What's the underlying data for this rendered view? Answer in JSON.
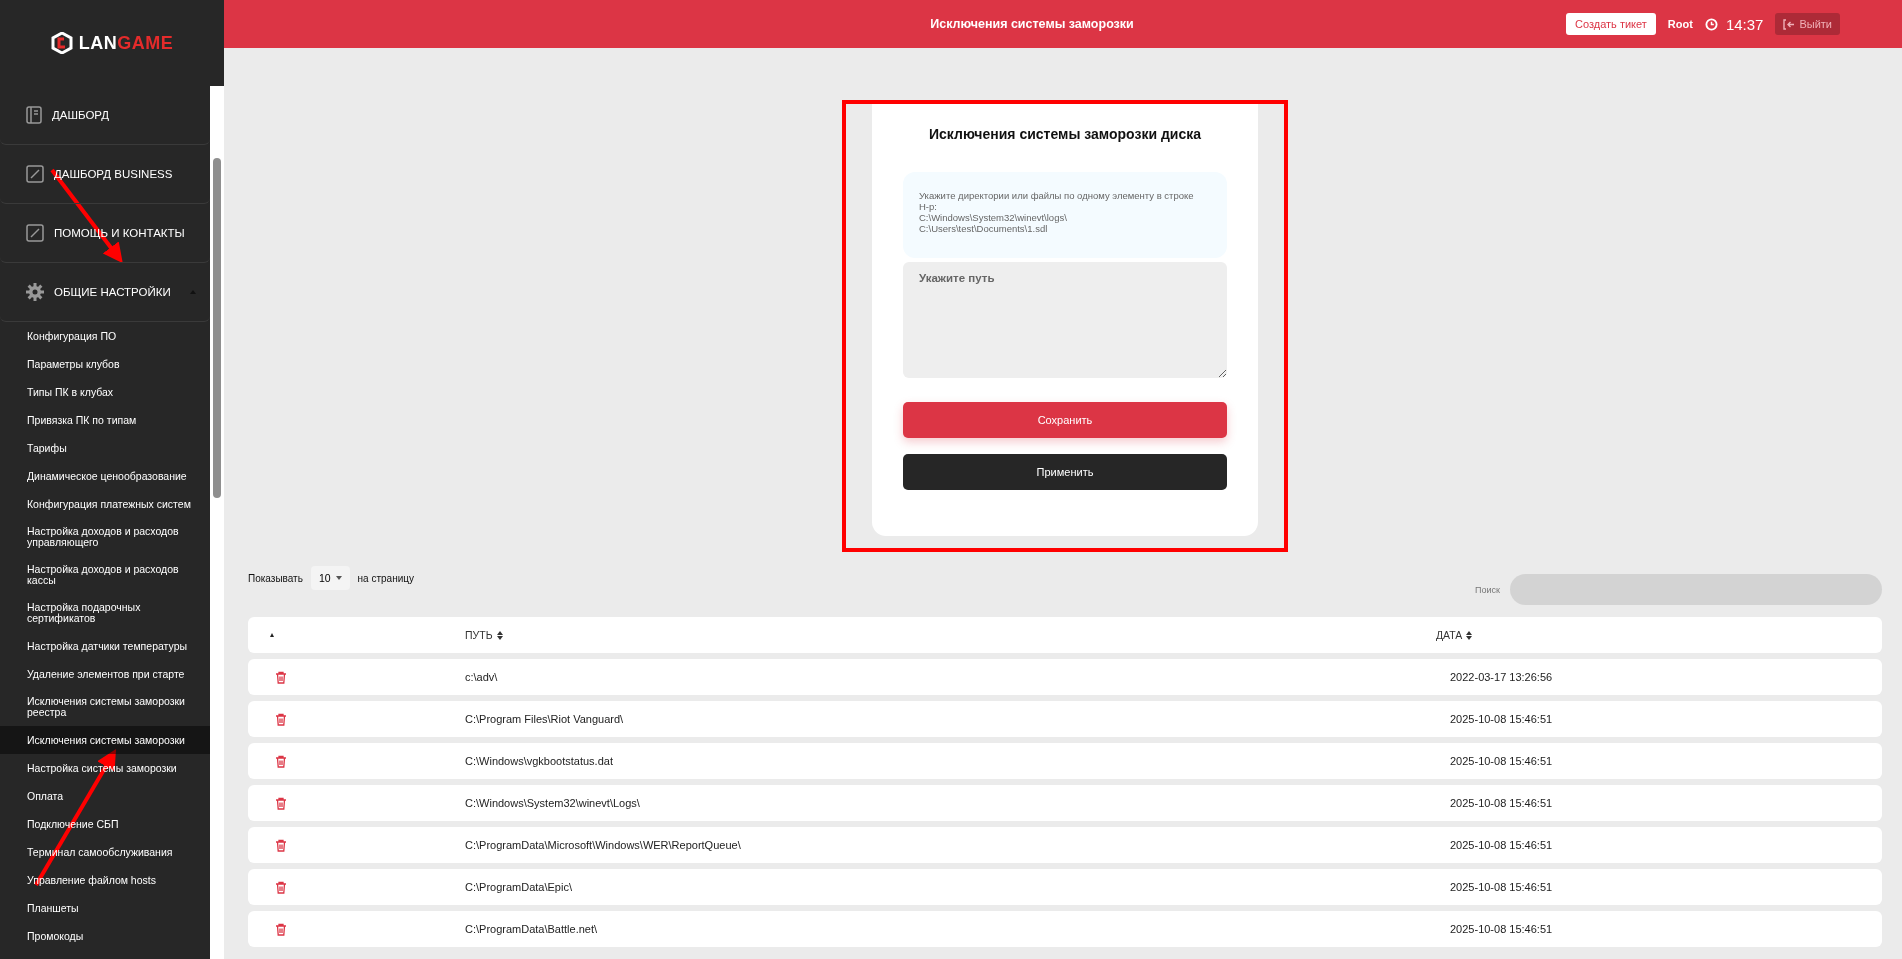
{
  "logo": {
    "text": "LAN",
    "accent": "GAME"
  },
  "sidebar": {
    "items": [
      {
        "kind": "dashboard",
        "label": "ДАШБОРД"
      },
      {
        "kind": "link",
        "label": "ДАШБОРД BUSINESS"
      },
      {
        "kind": "link",
        "label": "ПОМОЩЬ И КОНТАКТЫ"
      },
      {
        "kind": "group",
        "label": "ОБЩИЕ НАСТРОЙКИ",
        "expanded": true,
        "children": [
          {
            "label": "Конфигурация ПО",
            "selected": false
          },
          {
            "label": "Параметры клубов",
            "selected": false
          },
          {
            "label": "Типы ПК в клубах",
            "selected": false
          },
          {
            "label": "Привязка ПК по типам",
            "selected": false
          },
          {
            "label": "Тарифы",
            "selected": false
          },
          {
            "label": "Динамическое ценообразование",
            "selected": false
          },
          {
            "label": "Конфигурация платежных систем",
            "selected": false
          },
          {
            "label": "Настройка доходов и расходов управляющего",
            "selected": false
          },
          {
            "label": "Настройка доходов и расходов кассы",
            "selected": false
          },
          {
            "label": "Настройка подарочных сертификатов",
            "selected": false
          },
          {
            "label": "Настройка датчики температуры",
            "selected": false
          },
          {
            "label": "Удаление элементов при старте",
            "selected": false
          },
          {
            "label": "Исключения системы заморозки реестра",
            "selected": false
          },
          {
            "label": "Исключения системы заморозки",
            "selected": true
          },
          {
            "label": "Настройка системы заморозки",
            "selected": false
          },
          {
            "label": "Оплата",
            "selected": false
          },
          {
            "label": "Подключение СБП",
            "selected": false
          },
          {
            "label": "Терминал самообслуживания",
            "selected": false
          },
          {
            "label": "Управление файлом hosts",
            "selected": false
          },
          {
            "label": "Планшеты",
            "selected": false
          },
          {
            "label": "Промокоды",
            "selected": false
          }
        ]
      }
    ]
  },
  "header": {
    "title": "Исключения системы заморозки",
    "ticket_button": "Создать тикет",
    "user": "Root",
    "time": "14:37",
    "logout_button": "Выйти"
  },
  "card": {
    "title": "Исключения системы заморозки диска",
    "hint": "Укажите директории или файлы по одному элементу в строке\nН-р:\nC:\\Windows\\System32\\winevt\\logs\\\nC:\\Users\\test\\Documents\\1.sdl",
    "path_field": {
      "placeholder": "Укажите путь"
    },
    "save_button": "Сохранить",
    "apply_button": "Применить"
  },
  "pagination": {
    "show_label": "Показывать",
    "page_size": "10",
    "per_page_label": "на страницу"
  },
  "search": {
    "label": "Поиск"
  },
  "table": {
    "columns": [
      {
        "kind": "sort-only"
      },
      {
        "label": "ПУТЬ",
        "kind": "sortable"
      },
      {
        "label": "ДАТА",
        "kind": "sortable"
      }
    ],
    "rows": [
      {
        "path": "c:\\adv\\",
        "date": "2022-03-17 13:26:56"
      },
      {
        "path": "C:\\Program Files\\Riot Vanguard\\",
        "date": "2025-10-08 15:46:51"
      },
      {
        "path": "C:\\Windows\\vgkbootstatus.dat",
        "date": "2025-10-08 15:46:51"
      },
      {
        "path": "C:\\Windows\\System32\\winevt\\Logs\\",
        "date": "2025-10-08 15:46:51"
      },
      {
        "path": "C:\\ProgramData\\Microsoft\\Windows\\WER\\ReportQueue\\",
        "date": "2025-10-08 15:46:51"
      },
      {
        "path": "C:\\ProgramData\\Epic\\",
        "date": "2025-10-08 15:46:51"
      },
      {
        "path": "C:\\ProgramData\\Battle.net\\",
        "date": "2025-10-08 15:46:51"
      }
    ]
  }
}
